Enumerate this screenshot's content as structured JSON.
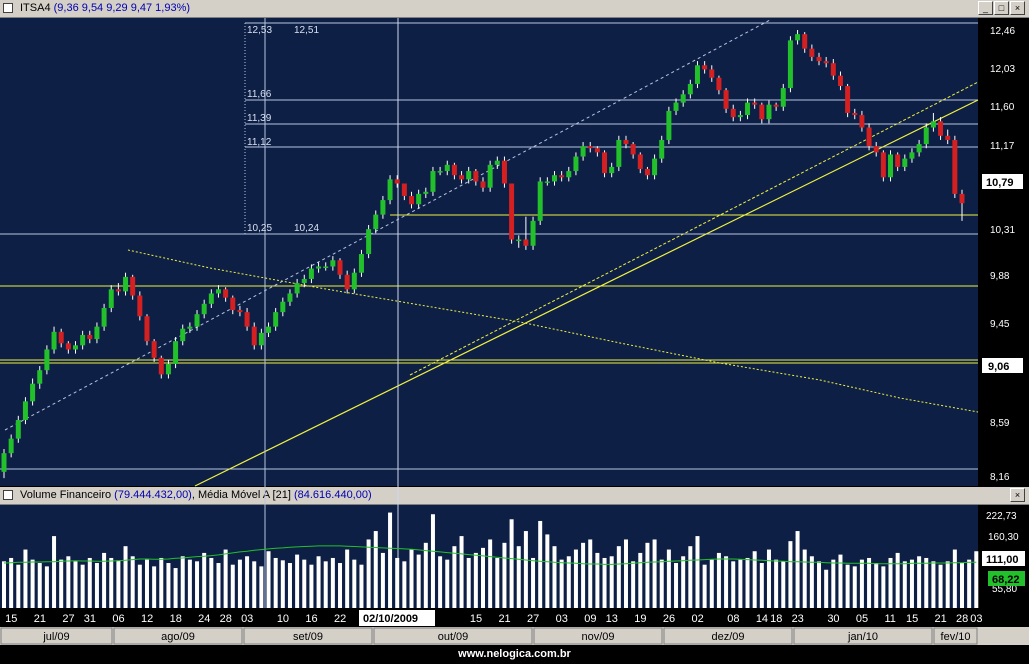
{
  "price_panel": {
    "symbol": "ITSA4",
    "ohlc_text": "(9,36  9,54  9,29  9,47  1,93%)",
    "y_ticks": [
      "12,46",
      "12,03",
      "11,60",
      "11,17",
      "10,31",
      "9,88",
      "9,45",
      "8,59",
      "8,16"
    ],
    "last_price_badge": "10,79",
    "level_badge": "9,06",
    "annotations": [
      "12,53",
      "12,51",
      "11,66",
      "11,39",
      "11,12",
      "10,25",
      "10,24"
    ]
  },
  "volume_panel": {
    "title": "Volume Financeiro",
    "value_text": "(79.444.432,00)",
    "ma_label": ", Média Móvel A [21]",
    "ma_value_text": "(84.616.440,00)",
    "y_ticks": [
      "222,73",
      "160,30"
    ],
    "badge_volume": "111,00",
    "badge_ma": "68,22",
    "badge_partial": "55,80"
  },
  "time_axis": {
    "day_labels": [
      "15",
      "21",
      "27",
      "31",
      "06",
      "12",
      "18",
      "24",
      "28",
      "03",
      "10",
      "16",
      "22",
      "15",
      "21",
      "27",
      "03",
      "09",
      "13",
      "19",
      "26",
      "02",
      "08",
      "14",
      "18",
      "23",
      "30",
      "05",
      "11",
      "15",
      "21",
      "28",
      "03"
    ],
    "cursor_date": "02/10/2009",
    "months": [
      "jul/09",
      "ago/09",
      "set/09",
      "out/09",
      "nov/09",
      "dez/09",
      "jan/10",
      "fev/10"
    ]
  },
  "window_buttons": {
    "minimize": "_",
    "maximize": "□",
    "close": "×"
  },
  "footer": {
    "text": "www.nelogica.com.br"
  },
  "colors": {
    "background": "#0d1f45",
    "up": "#22c02a",
    "down": "#d42020",
    "volume": "#ffffff",
    "ma": "#22c02a",
    "trend": "#f0f040",
    "grid": "#b8c4e0"
  },
  "chart_data": [
    {
      "type": "candlestick",
      "title": "ITSA4",
      "ylim": [
        8.1,
        12.6
      ],
      "x": [
        "2009-07-14",
        "2009-07-15",
        "2009-07-16",
        "2009-07-17",
        "2009-07-20",
        "2009-07-21",
        "2009-07-22",
        "2009-07-23",
        "2009-07-24",
        "2009-07-27",
        "2009-07-28",
        "2009-07-29",
        "2009-07-30",
        "2009-07-31",
        "2009-08-03",
        "2009-08-04",
        "2009-08-05",
        "2009-08-06",
        "2009-08-07",
        "2009-08-10",
        "2009-08-11",
        "2009-08-12",
        "2009-08-13",
        "2009-08-14",
        "2009-08-17",
        "2009-08-18",
        "2009-08-19",
        "2009-08-20",
        "2009-08-21",
        "2009-08-24",
        "2009-08-25",
        "2009-08-26",
        "2009-08-27",
        "2009-08-28",
        "2009-08-31",
        "2009-09-01",
        "2009-09-02",
        "2009-09-03",
        "2009-09-04",
        "2009-09-08",
        "2009-09-09",
        "2009-09-10",
        "2009-09-11",
        "2009-09-14",
        "2009-09-15",
        "2009-09-16",
        "2009-09-17",
        "2009-09-18",
        "2009-09-21",
        "2009-09-22",
        "2009-09-23",
        "2009-09-24",
        "2009-09-25",
        "2009-09-28",
        "2009-09-29",
        "2009-09-30",
        "2009-10-01",
        "2009-10-02",
        "2009-10-05",
        "2009-10-06",
        "2009-10-07",
        "2009-10-08",
        "2009-10-09",
        "2009-10-13",
        "2009-10-14",
        "2009-10-15",
        "2009-10-16",
        "2009-10-19",
        "2009-10-20",
        "2009-10-21",
        "2009-10-22",
        "2009-10-23",
        "2009-10-26",
        "2009-10-27",
        "2009-10-28",
        "2009-10-29",
        "2009-10-30",
        "2009-11-03",
        "2009-11-04",
        "2009-11-05",
        "2009-11-06",
        "2009-11-09",
        "2009-11-10",
        "2009-11-11",
        "2009-11-12",
        "2009-11-13",
        "2009-11-16",
        "2009-11-17",
        "2009-11-18",
        "2009-11-19",
        "2009-11-23",
        "2009-11-24",
        "2009-11-25",
        "2009-11-26",
        "2009-11-27",
        "2009-11-30",
        "2009-12-01",
        "2009-12-02",
        "2009-12-03",
        "2009-12-04",
        "2009-12-07",
        "2009-12-08",
        "2009-12-09",
        "2009-12-10",
        "2009-12-11",
        "2009-12-14",
        "2009-12-15",
        "2009-12-16",
        "2009-12-17",
        "2009-12-18",
        "2009-12-21",
        "2009-12-22",
        "2009-12-23",
        "2009-12-28",
        "2009-12-29",
        "2009-12-30",
        "2010-01-04",
        "2010-01-05",
        "2010-01-06",
        "2010-01-07",
        "2010-01-08",
        "2010-01-11",
        "2010-01-12",
        "2010-01-13",
        "2010-01-14",
        "2010-01-15",
        "2010-01-18",
        "2010-01-19",
        "2010-01-20",
        "2010-01-21",
        "2010-01-22",
        "2010-01-26",
        "2010-01-27",
        "2010-01-28",
        "2010-01-29",
        "2010-02-01",
        "2010-02-02",
        "2010-02-03",
        "2010-02-04"
      ],
      "open": [
        8.2,
        8.38,
        8.52,
        8.7,
        8.88,
        9.05,
        9.18,
        9.38,
        9.55,
        9.44,
        9.38,
        9.42,
        9.52,
        9.48,
        9.6,
        9.78,
        9.96,
        9.94,
        10.08,
        9.9,
        9.7,
        9.46,
        9.3,
        9.14,
        9.24,
        9.46,
        9.58,
        9.6,
        9.72,
        9.82,
        9.92,
        9.96,
        9.88,
        9.76,
        9.74,
        9.6,
        9.42,
        9.54,
        9.6,
        9.74,
        9.84,
        9.92,
        10.02,
        10.06,
        10.16,
        10.18,
        10.18,
        10.24,
        10.1,
        9.96,
        10.12,
        10.3,
        10.54,
        10.68,
        10.82,
        11.02,
        10.98,
        10.86,
        10.78,
        10.88,
        10.9,
        11.1,
        11.1,
        11.16,
        11.06,
        11.02,
        11.1,
        11.0,
        10.94,
        11.16,
        11.2,
        10.98,
        10.44,
        10.44,
        10.38,
        10.62,
        11.0,
        11.0,
        11.06,
        11.04,
        11.1,
        11.24,
        11.34,
        11.32,
        11.28,
        11.08,
        11.14,
        11.4,
        11.36,
        11.26,
        11.12,
        11.06,
        11.22,
        11.4,
        11.68,
        11.76,
        11.84,
        11.94,
        12.12,
        12.08,
        12.0,
        11.88,
        11.7,
        11.62,
        11.64,
        11.76,
        11.74,
        11.6,
        11.74,
        11.72,
        11.9,
        12.36,
        12.42,
        12.28,
        12.2,
        12.16,
        12.14,
        12.02,
        11.92,
        11.66,
        11.64,
        11.52,
        11.34,
        11.28,
        11.04,
        11.26,
        11.14,
        11.22,
        11.28,
        11.36,
        11.52,
        11.58,
        11.44,
        11.4,
        10.88
      ],
      "close": [
        8.38,
        8.52,
        8.7,
        8.88,
        9.05,
        9.18,
        9.38,
        9.55,
        9.44,
        9.38,
        9.42,
        9.52,
        9.48,
        9.6,
        9.78,
        9.96,
        9.94,
        10.08,
        9.9,
        9.7,
        9.46,
        9.3,
        9.14,
        9.24,
        9.46,
        9.58,
        9.6,
        9.72,
        9.82,
        9.92,
        9.96,
        9.88,
        9.76,
        9.74,
        9.6,
        9.42,
        9.54,
        9.6,
        9.74,
        9.84,
        9.92,
        10.02,
        10.06,
        10.16,
        10.18,
        10.18,
        10.24,
        10.1,
        9.96,
        10.12,
        10.3,
        10.54,
        10.68,
        10.82,
        11.02,
        10.98,
        10.86,
        10.78,
        10.88,
        10.9,
        11.1,
        11.1,
        11.16,
        11.06,
        11.02,
        11.1,
        11.0,
        10.94,
        11.16,
        11.2,
        10.98,
        10.44,
        10.44,
        10.38,
        10.62,
        11.0,
        11.0,
        11.06,
        11.04,
        11.1,
        11.24,
        11.34,
        11.32,
        11.28,
        11.08,
        11.14,
        11.4,
        11.36,
        11.26,
        11.12,
        11.06,
        11.22,
        11.4,
        11.68,
        11.76,
        11.84,
        11.94,
        12.12,
        12.08,
        12.0,
        11.88,
        11.7,
        11.62,
        11.64,
        11.76,
        11.74,
        11.6,
        11.74,
        11.72,
        11.9,
        12.36,
        12.42,
        12.28,
        12.2,
        12.16,
        12.14,
        12.02,
        11.92,
        11.66,
        11.64,
        11.52,
        11.34,
        11.28,
        11.04,
        11.26,
        11.14,
        11.22,
        11.28,
        11.36,
        11.52,
        11.58,
        11.44,
        11.4,
        10.88,
        10.79
      ],
      "high": [
        8.42,
        8.56,
        8.74,
        8.92,
        9.1,
        9.22,
        9.42,
        9.6,
        9.58,
        9.46,
        9.46,
        9.56,
        9.56,
        9.64,
        9.82,
        10.0,
        10.02,
        10.12,
        10.1,
        9.94,
        9.72,
        9.48,
        9.32,
        9.28,
        9.5,
        9.62,
        9.64,
        9.76,
        9.86,
        9.96,
        10.0,
        9.98,
        9.9,
        9.8,
        9.78,
        9.64,
        9.58,
        9.64,
        9.78,
        9.88,
        9.96,
        10.06,
        10.1,
        10.2,
        10.22,
        10.22,
        10.28,
        10.26,
        10.14,
        10.16,
        10.34,
        10.58,
        10.72,
        10.86,
        11.06,
        11.06,
        10.98,
        10.9,
        10.92,
        10.94,
        11.14,
        11.14,
        11.2,
        11.18,
        11.1,
        11.14,
        11.12,
        11.04,
        11.2,
        11.24,
        11.24,
        10.98,
        10.48,
        10.66,
        10.66,
        11.04,
        11.04,
        11.1,
        11.1,
        11.14,
        11.28,
        11.38,
        11.38,
        11.34,
        11.3,
        11.18,
        11.44,
        11.44,
        11.38,
        11.28,
        11.14,
        11.26,
        11.44,
        11.72,
        11.8,
        11.88,
        11.98,
        12.16,
        12.16,
        12.12,
        12.02,
        11.9,
        11.74,
        11.68,
        11.8,
        11.8,
        11.76,
        11.78,
        11.76,
        11.94,
        12.4,
        12.46,
        12.44,
        12.32,
        12.24,
        12.2,
        12.18,
        12.06,
        11.94,
        11.7,
        11.68,
        11.56,
        11.38,
        11.3,
        11.3,
        11.28,
        11.26,
        11.32,
        11.4,
        11.56,
        11.66,
        11.62,
        11.5,
        11.44,
        10.92
      ],
      "low": [
        8.14,
        8.34,
        8.48,
        8.66,
        8.84,
        9.0,
        9.14,
        9.34,
        9.4,
        9.34,
        9.34,
        9.38,
        9.44,
        9.44,
        9.56,
        9.74,
        9.9,
        9.9,
        9.86,
        9.66,
        9.42,
        9.26,
        9.1,
        9.1,
        9.2,
        9.42,
        9.54,
        9.56,
        9.68,
        9.78,
        9.88,
        9.84,
        9.72,
        9.7,
        9.56,
        9.38,
        9.38,
        9.5,
        9.56,
        9.7,
        9.8,
        9.88,
        9.98,
        10.02,
        10.12,
        10.14,
        10.14,
        10.06,
        9.92,
        9.92,
        10.08,
        10.26,
        10.5,
        10.64,
        10.78,
        10.94,
        10.82,
        10.74,
        10.74,
        10.84,
        10.86,
        11.06,
        11.06,
        11.02,
        10.98,
        10.98,
        10.96,
        10.9,
        10.9,
        11.12,
        10.94,
        10.4,
        10.36,
        10.34,
        10.34,
        10.58,
        10.96,
        10.96,
        11.0,
        11.0,
        11.06,
        11.2,
        11.28,
        11.24,
        11.04,
        11.04,
        11.1,
        11.32,
        11.22,
        11.08,
        11.02,
        11.02,
        11.18,
        11.36,
        11.64,
        11.72,
        11.8,
        11.9,
        12.04,
        11.96,
        11.84,
        11.66,
        11.58,
        11.58,
        11.6,
        11.7,
        11.56,
        11.56,
        11.68,
        11.68,
        11.86,
        12.32,
        12.24,
        12.16,
        12.12,
        12.1,
        11.98,
        11.88,
        11.62,
        11.6,
        11.48,
        11.3,
        11.24,
        11.0,
        11.0,
        11.1,
        11.1,
        11.18,
        11.24,
        11.32,
        11.48,
        11.4,
        11.36,
        10.84,
        10.62
      ]
    },
    {
      "type": "bar",
      "title": "Volume Financeiro",
      "ylim": [
        0,
        240
      ],
      "series": [
        {
          "name": "Volume Financeiro",
          "values": [
            85,
            95,
            75,
            120,
            90,
            80,
            70,
            160,
            90,
            100,
            85,
            75,
            95,
            80,
            110,
            95,
            88,
            130,
            100,
            75,
            90,
            70,
            95,
            80,
            65,
            100,
            90,
            85,
            110,
            95,
            80,
            120,
            75,
            90,
            100,
            85,
            70,
            115,
            95,
            88,
            80,
            105,
            90,
            75,
            100,
            85,
            95,
            80,
            120,
            90,
            75,
            150,
            175,
            110,
            230,
            95,
            85,
            120,
            105,
            140,
            225,
            100,
            90,
            130,
            160,
            95,
            110,
            125,
            150,
            95,
            140,
            210,
            130,
            175,
            95,
            205,
            165,
            130,
            90,
            100,
            120,
            140,
            150,
            110,
            95,
            100,
            130,
            150,
            85,
            110,
            140,
            150,
            90,
            120,
            80,
            100,
            130,
            160,
            75,
            90,
            110,
            100,
            85,
            90,
            95,
            115,
            80,
            120,
            90,
            85,
            145,
            175,
            120,
            100,
            85,
            60,
            90,
            105,
            75,
            70,
            90,
            95,
            80,
            70,
            95,
            110,
            85,
            90,
            100,
            95,
            85,
            75,
            85,
            120,
            80,
            90,
            115
          ]
        },
        {
          "name": "Média Móvel A [21]",
          "values": [
            80,
            81,
            82,
            82,
            83,
            83,
            84,
            84,
            85,
            86,
            87,
            86,
            86,
            85,
            85,
            86,
            87,
            88,
            90,
            92,
            92,
            91,
            91,
            92,
            94,
            95,
            97,
            99,
            100,
            102,
            104,
            107,
            110,
            113,
            115,
            118,
            120,
            122,
            124,
            125,
            127,
            128,
            129,
            130,
            131,
            131,
            131,
            131,
            130,
            129,
            128,
            127,
            126,
            125,
            124,
            123,
            122,
            121,
            119,
            117,
            115,
            113,
            111,
            109,
            107,
            105,
            103,
            101,
            99,
            97,
            95,
            93,
            91,
            89,
            87,
            85,
            84,
            82,
            81,
            80,
            79,
            78,
            77,
            77,
            76,
            76,
            77,
            78,
            79,
            81,
            82,
            83,
            84,
            85,
            86,
            87,
            88,
            89,
            90,
            91,
            92,
            92,
            92,
            91,
            90,
            89,
            88,
            87,
            86,
            85,
            84,
            84,
            83,
            82,
            82,
            81,
            80,
            80,
            79,
            79,
            79,
            79,
            78,
            78,
            78,
            78,
            78,
            79,
            79,
            79,
            80,
            80,
            80,
            81,
            81,
            82,
            82
          ]
        }
      ]
    }
  ]
}
